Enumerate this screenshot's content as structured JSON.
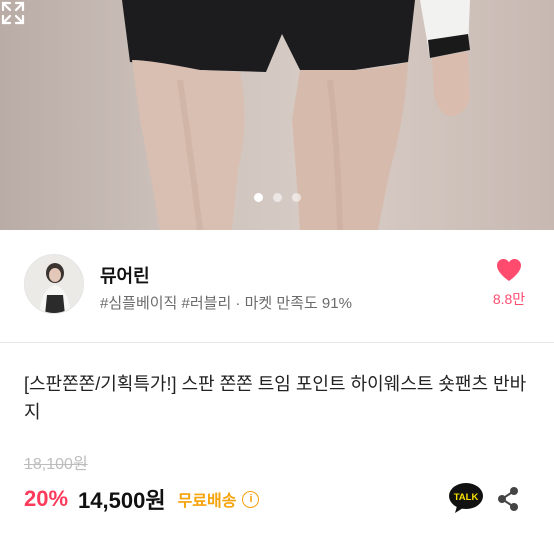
{
  "gallery": {
    "slide_count": 3,
    "active_index": 0,
    "icons": {
      "expand": "expand-icon"
    }
  },
  "seller": {
    "name": "뮤어린",
    "meta": "#심플베이직 #러블리 · 마켓 만족도 91%",
    "like_count": "8.8만",
    "colors": {
      "like": "#ff4b6e"
    }
  },
  "product": {
    "title": "[스판쫀쫀/기획특가!] 스판 쫀쫀 트임 포인트 하이웨스트 숏팬츠 반바지",
    "original_price": "18,100원",
    "discount": "20%",
    "price": "14,500원",
    "shipping": "무료배송",
    "talk_badge": "TALK",
    "colors": {
      "discount": "#ff3b5c",
      "shipping": "#f5a30a"
    }
  }
}
